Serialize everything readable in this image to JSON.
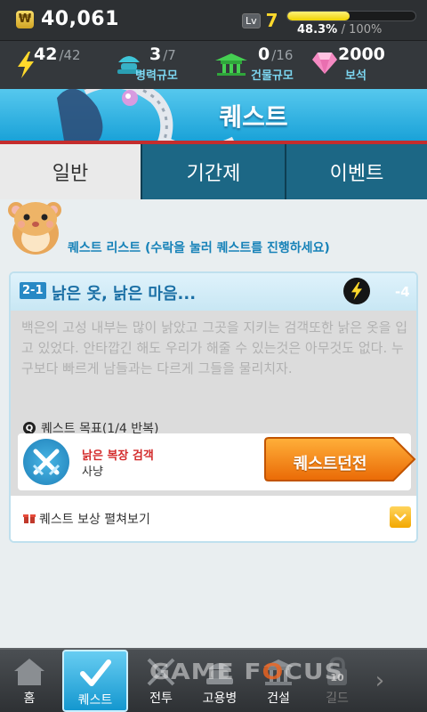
{
  "status": {
    "gold_symbol": "₩",
    "gold": "40,061",
    "level_badge": "Lv",
    "level": "7",
    "xp_fraction": 0.483,
    "xp_percent": "48.3%",
    "xp_max": "/ 100%"
  },
  "resources": {
    "energy_current": "42",
    "energy_max": "/42",
    "troops_current": "3",
    "troops_max": "/7",
    "troops_label": "병력규모",
    "buildings_current": "0",
    "buildings_max": "/16",
    "buildings_label": "건물규모",
    "gems": "2000",
    "gems_label": "보석"
  },
  "header": {
    "title": "퀘스트"
  },
  "tabs": [
    {
      "label": "일반",
      "active": true
    },
    {
      "label": "기간제",
      "active": false
    },
    {
      "label": "이벤트",
      "active": false
    }
  ],
  "list_label": "퀘스트 리스트 (수락을 눌러 퀘스트를 진행하세요)",
  "quest": {
    "number": "2-1",
    "title": "낡은 옷, 낡은 마음...",
    "energy_cost": "-4",
    "description": "백은의 고성 내부는 많이 낡았고 그곳을 지키는 검객또한 낡은 옷을 입고 있었다. 안타깝긴 해도 우리가 해줄 수 있는것은 아무것도 없다. 누구보다 빠르게 남들과는 다르게 그들을 물리치자.",
    "goal_icon_letter": "Q",
    "goal_label": "퀘스트 목표(1/4 반복)",
    "goal_name": "낡은 복장 검객",
    "goal_type": "사냥",
    "dungeon_button": "퀘스트던전",
    "reward_label": "퀘스트 보상 펼쳐보기"
  },
  "nav": [
    {
      "label": "홈",
      "icon": "home-icon"
    },
    {
      "label": "퀘스트",
      "icon": "check-icon",
      "active": true
    },
    {
      "label": "전투",
      "icon": "swords-icon"
    },
    {
      "label": "고용병",
      "icon": "mercenary-icon"
    },
    {
      "label": "건설",
      "icon": "building-icon"
    },
    {
      "label": "길드",
      "icon": "lock-icon",
      "lock_level": "10"
    }
  ],
  "watermark": {
    "text_a": "GAME F",
    "text_o": "O",
    "text_b": "CUS"
  },
  "colors": {
    "accent": "#1aa2d8",
    "banner_border": "#c42d2d",
    "gold": "#ffd92c",
    "button_orange": "#f07d10"
  }
}
